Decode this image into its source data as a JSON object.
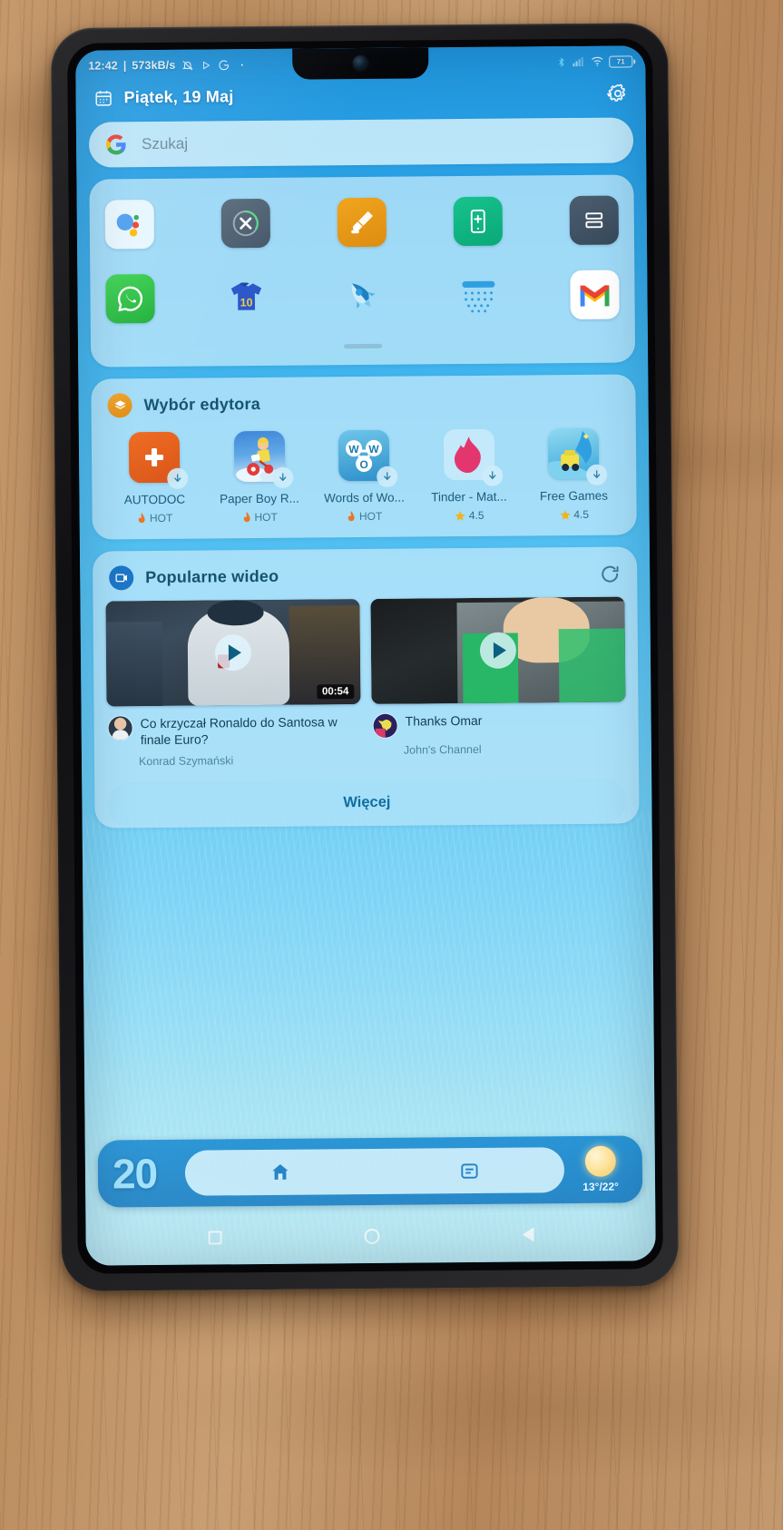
{
  "status_bar": {
    "time": "12:42",
    "separator": "|",
    "net_speed": "573kB/s",
    "icons_left": [
      "mute-icon",
      "play-icon",
      "google-icon",
      "dot-icon"
    ],
    "icons_right": [
      "bluetooth-icon",
      "signal-icon",
      "wifi-icon"
    ],
    "battery_level": "71"
  },
  "header": {
    "date": "Piątek, 19 Maj",
    "calendar_icon": "calendar-icon",
    "settings_icon": "gear-icon"
  },
  "search": {
    "placeholder": "Szukaj",
    "logo": "google-g-icon"
  },
  "app_grid": {
    "row1": [
      {
        "name": "Google Assistant",
        "icon": "assistant-icon"
      },
      {
        "name": "Cleaner",
        "icon": "close-circle-icon"
      },
      {
        "name": "Brush Tool",
        "icon": "brush-icon"
      },
      {
        "name": "Phone Boost",
        "icon": "phone-plus-icon"
      },
      {
        "name": "List App",
        "icon": "list-icon"
      }
    ],
    "row2": [
      {
        "name": "WhatsApp",
        "icon": "whatsapp-icon"
      },
      {
        "name": "Football Jersey",
        "icon": "jersey-icon",
        "number": "10"
      },
      {
        "name": "Rocket Boost",
        "icon": "rocket-icon"
      },
      {
        "name": "Rain Widget",
        "icon": "shower-icon"
      },
      {
        "name": "Gmail",
        "icon": "gmail-icon"
      }
    ]
  },
  "editor_pick": {
    "title": "Wybór edytora",
    "icon": "layers-icon",
    "apps": [
      {
        "label": "AUTODOC",
        "badge": "HOT",
        "badge_type": "hot",
        "icon": "autodoc-icon"
      },
      {
        "label": "Paper Boy R...",
        "badge": "HOT",
        "badge_type": "hot",
        "icon": "paperboy-icon"
      },
      {
        "label": "Words of Wo...",
        "badge": "HOT",
        "badge_type": "hot",
        "icon": "wordsofwonders-icon"
      },
      {
        "label": "Tinder - Mat...",
        "badge": "4.5",
        "badge_type": "rating",
        "icon": "tinder-icon"
      },
      {
        "label": "Free Games",
        "badge": "4.5",
        "badge_type": "rating",
        "icon": "freegames-icon"
      }
    ]
  },
  "videos": {
    "title": "Popularne wideo",
    "icon": "video-play-icon",
    "refresh_icon": "refresh-icon",
    "items": [
      {
        "title": "Co krzyczał Ronaldo do Santosa w finale Euro?",
        "channel": "Konrad Szymański",
        "duration": "00:54"
      },
      {
        "title": "Thanks Omar",
        "channel": "John's Channel",
        "duration": ""
      }
    ],
    "more_label": "Więcej"
  },
  "dock": {
    "clock": "20",
    "home_icon": "home-icon",
    "messages_icon": "message-icon",
    "weather_icon": "sun-icon",
    "temperature": "13°/22°"
  },
  "navbar": {
    "recent": "recents-square-icon",
    "home": "home-circle-icon",
    "back": "back-triangle-icon"
  },
  "colors": {
    "accent": "#1e9ae0",
    "card": "#bae6fa",
    "title": "#15546e",
    "hot": "#e8762a",
    "star": "#f2b21c"
  }
}
